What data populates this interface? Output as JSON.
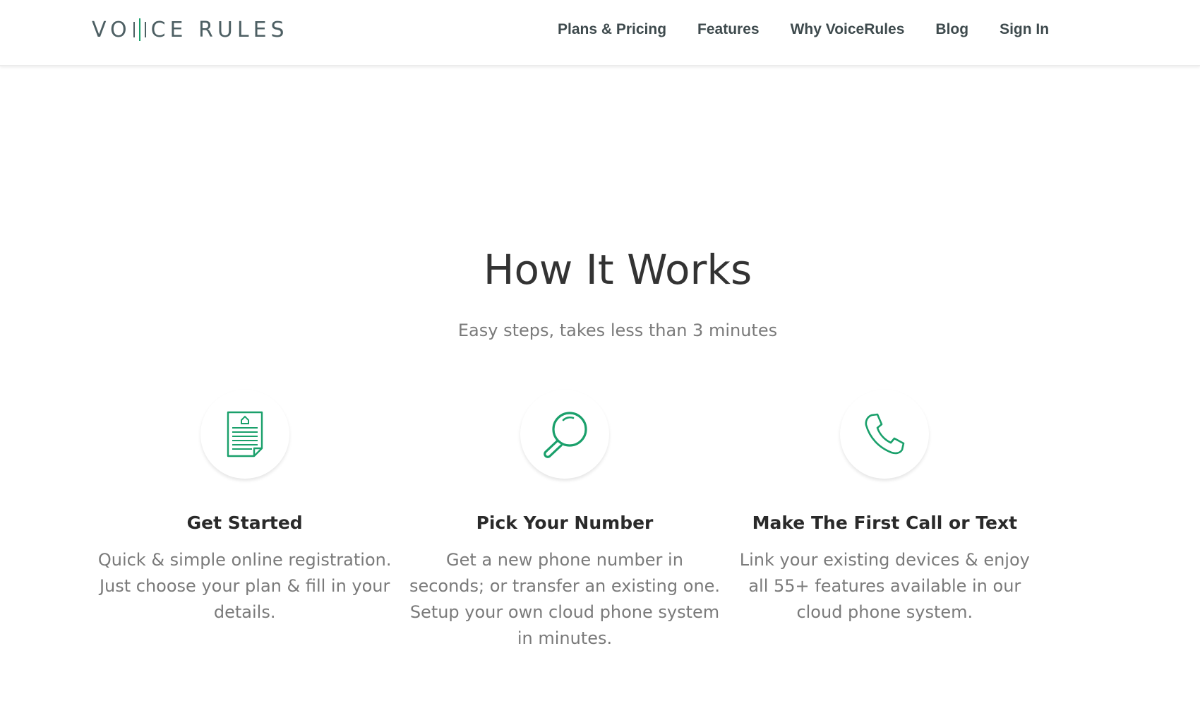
{
  "header": {
    "logo": {
      "left_text": "VO",
      "right_text": "CE RULES",
      "brand_color": "#4d5f63",
      "accent_color": "#1aa06b"
    },
    "nav": [
      {
        "label": "Plans & Pricing"
      },
      {
        "label": "Features"
      },
      {
        "label": "Why VoiceRules"
      },
      {
        "label": "Blog"
      },
      {
        "label": "Sign In"
      }
    ]
  },
  "main": {
    "title": "How It Works",
    "subtitle": "Easy steps, takes less than 3 minutes",
    "steps": [
      {
        "icon": "document-icon",
        "title": "Get Started",
        "description": "Quick & simple online registration. Just choose your plan & fill in your details."
      },
      {
        "icon": "magnifier-icon",
        "title": "Pick Your Number",
        "description": "Get a new phone number in seconds; or transfer an existing one. Setup your own cloud phone system in minutes."
      },
      {
        "icon": "phone-icon",
        "title": "Make The First Call or Text",
        "description": "Link your existing devices & enjoy all 55+ features available in our cloud phone system."
      }
    ]
  },
  "colors": {
    "accent": "#1aa06b",
    "heading": "#333333",
    "muted": "#7a7a7a",
    "nav_text": "#3e4a4d"
  }
}
